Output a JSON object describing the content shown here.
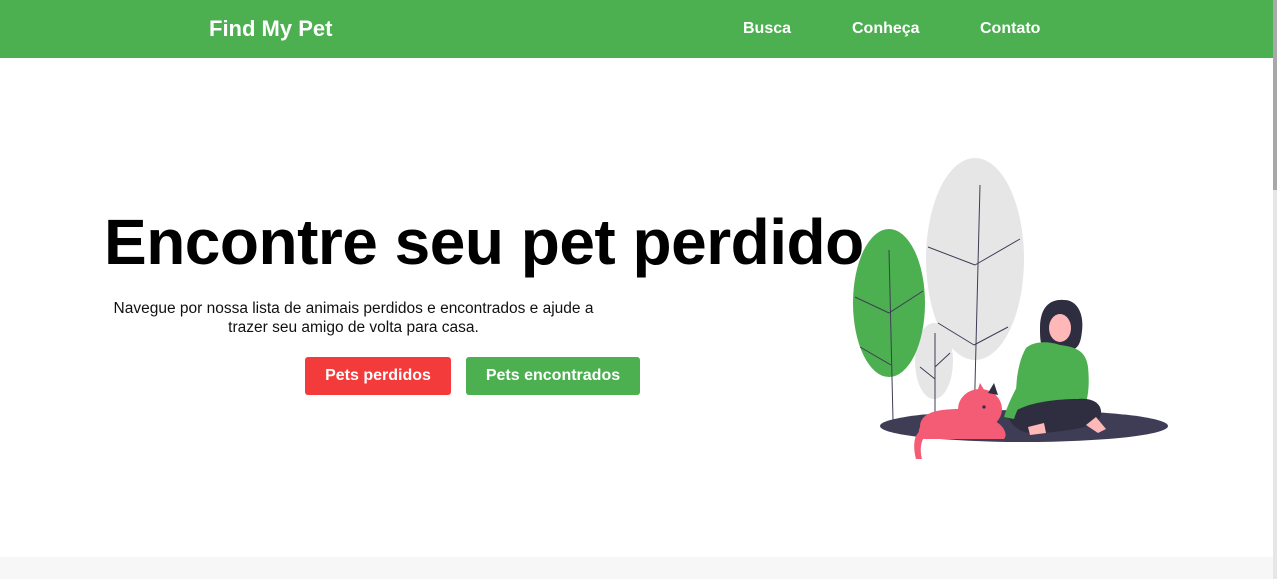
{
  "navbar": {
    "brand": "Find My Pet",
    "links": [
      {
        "label": "Busca"
      },
      {
        "label": "Conheça"
      },
      {
        "label": "Contato"
      }
    ]
  },
  "hero": {
    "title": "Encontre seu pet perdido",
    "subtitle": "Navegue por nossa lista de animais perdidos e encontrados e ajude a trazer seu amigo de volta para casa.",
    "buttons": {
      "lost_label": "Pets perdidos",
      "found_label": "Pets encontrados"
    }
  },
  "illustration": {
    "icon": "woman-with-cat-illustration"
  },
  "colors": {
    "primary": "#4caf50",
    "danger": "#f43b3b",
    "text": "#000000",
    "cat": "#f45b74",
    "shadow": "#3f3d56",
    "leaf_gray": "#e6e6e6"
  }
}
